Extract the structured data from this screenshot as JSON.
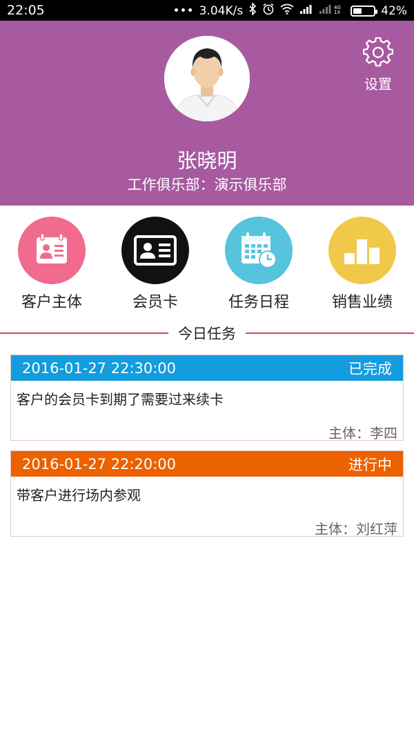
{
  "status_bar": {
    "time": "22:05",
    "network_speed": "3.04K/s",
    "network_type": "4G",
    "battery_percent": "42%",
    "battery_level": 0.42,
    "icons": [
      "more-dots-icon",
      "bluetooth-icon",
      "alarm-icon",
      "wifi-icon",
      "signal-icon",
      "signal-4g-icon",
      "battery-icon"
    ]
  },
  "header": {
    "bg_color": "#a75a9f",
    "user_name": "张晓明",
    "club_info": "工作俱乐部：演示俱乐部",
    "settings_label": "设置"
  },
  "menu": {
    "items": [
      {
        "label": "客户主体",
        "icon": "customer-profile-icon",
        "color": "#f06b8e"
      },
      {
        "label": "会员卡",
        "icon": "member-card-icon",
        "color": "#111111"
      },
      {
        "label": "任务日程",
        "icon": "calendar-schedule-icon",
        "color": "#55c4dc"
      },
      {
        "label": "销售业绩",
        "icon": "bar-chart-icon",
        "color": "#f0c84a"
      }
    ]
  },
  "today_tasks": {
    "title": "今日任务",
    "items": [
      {
        "datetime": "2016-01-27 22:30:00",
        "status": "已完成",
        "status_color": "#139cde",
        "description": "客户的会员卡到期了需要过来续卡",
        "subject": "主体：李四"
      },
      {
        "datetime": "2016-01-27 22:20:00",
        "status": "进行中",
        "status_color": "#ec6100",
        "description": "带客户进行场内参观",
        "subject": "主体：刘红萍"
      }
    ]
  }
}
